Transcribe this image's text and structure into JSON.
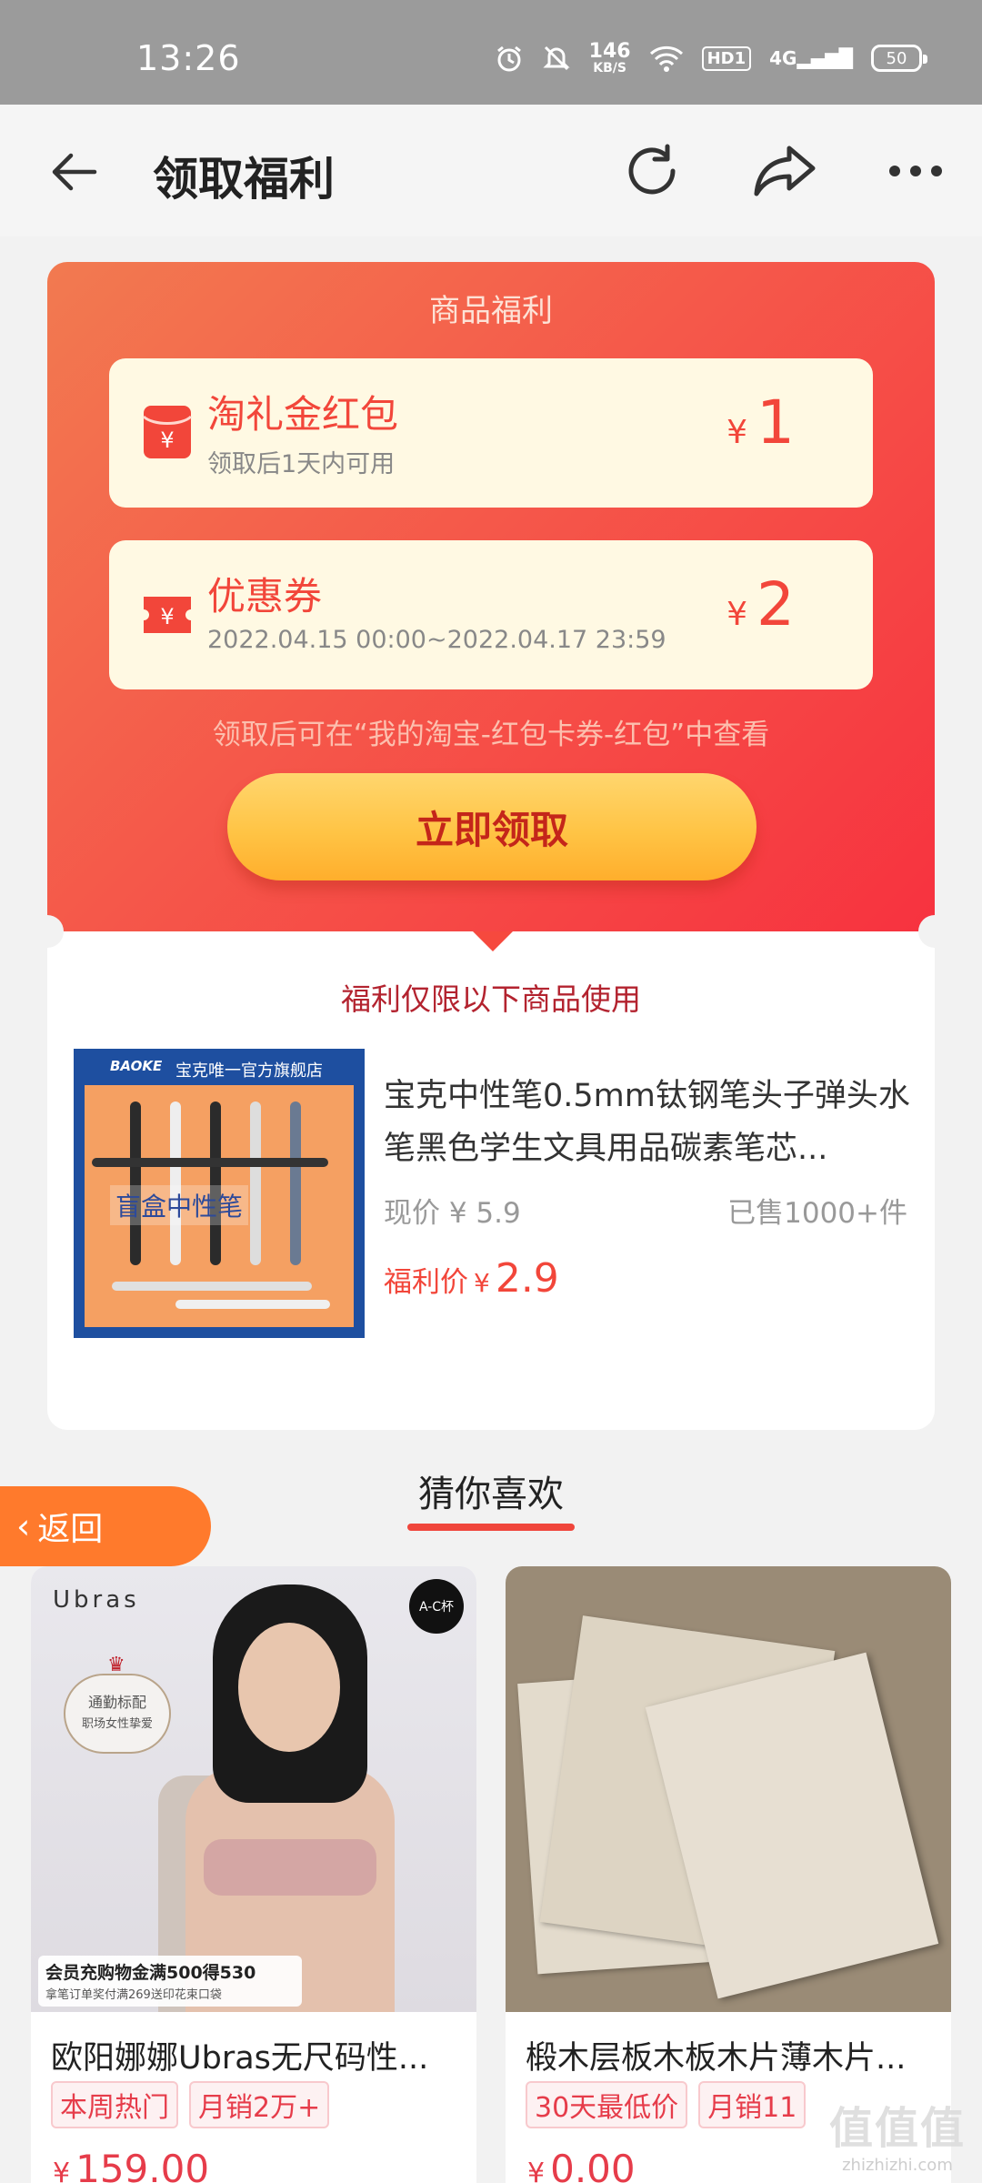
{
  "status_bar": {
    "time": "13:26",
    "net_speed": "146",
    "net_unit": "KB/S",
    "hd": "HD1",
    "signal": "4G",
    "battery": "50"
  },
  "nav": {
    "title": "领取福利",
    "back_icon": "arrow-left-icon",
    "refresh_icon": "refresh-icon",
    "share_icon": "share-icon",
    "more_icon": "more-icon"
  },
  "welfare": {
    "title": "商品福利",
    "items": [
      {
        "name": "淘礼金红包",
        "sub": "领取后1天内可用",
        "currency": "¥",
        "amount": "1",
        "icon": "red-envelope-icon"
      },
      {
        "name": "优惠券",
        "sub": "2022.04.15 00:00~2022.04.17 23:59",
        "currency": "¥",
        "amount": "2",
        "icon": "coupon-icon"
      }
    ],
    "note": "领取后可在“我的淘宝-红包卡券-红包”中查看",
    "claim_button": "立即领取"
  },
  "product": {
    "restrict_text": "福利仅限以下商品使用",
    "image_brand": "BAOKE",
    "image_store": "宝克唯一官方旗舰店",
    "image_tag": "盲盒中性笔",
    "title": "宝克中性笔0.5mm钛钢笔头子弹头水笔黑色学生文具用品碳素笔芯...",
    "current_price": "现价 ¥ 5.9",
    "sold": "已售1000+件",
    "welfare_label": "福利价",
    "welfare_currency": "¥",
    "welfare_price": "2.9"
  },
  "guess": {
    "title": "猜你喜欢",
    "back_label": "返回"
  },
  "feed": [
    {
      "title": "欧阳娜娜Ubras无尺码性...",
      "tags": [
        "本周热门",
        "月销2万+"
      ],
      "currency": "¥",
      "price": "159.00",
      "image_logo": "Ubras",
      "image_cup": "A-C杯",
      "image_badge_1": "通勤标配",
      "image_badge_2": "职场女性挚爱",
      "image_promo_1": "会员充购物金满500得530",
      "image_promo_2": "拿笔订单奖付满269送印花束口袋"
    },
    {
      "title": "椴木层板木板木片薄木片...",
      "tags": [
        "30天最低价",
        "月销11"
      ],
      "currency": "¥",
      "price": "0.00"
    }
  ],
  "watermark": {
    "logo": "值值值",
    "url": "zhizhizhi.com"
  }
}
